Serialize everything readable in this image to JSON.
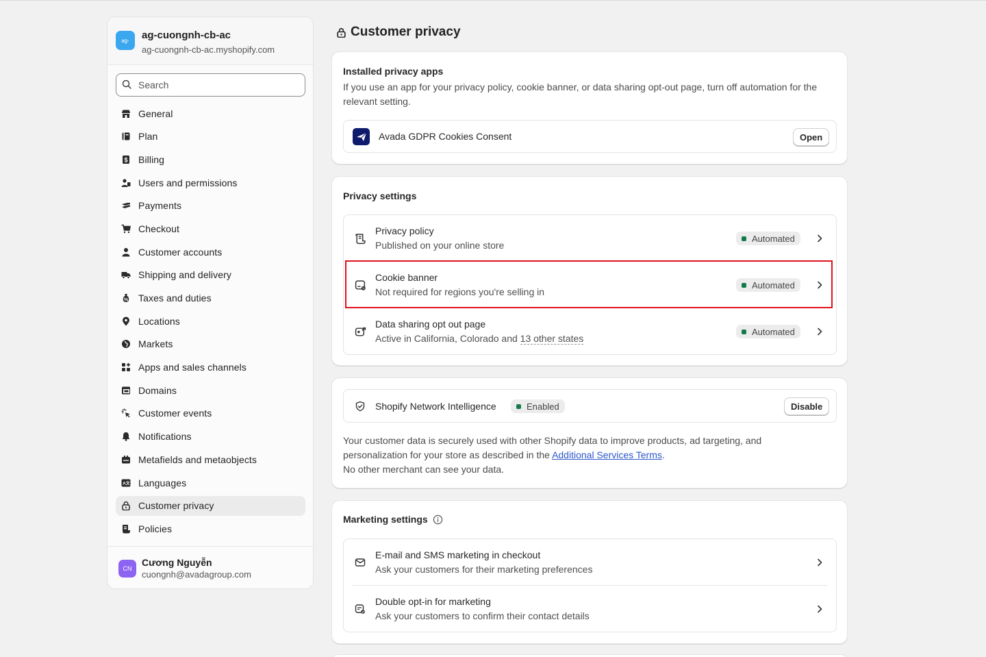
{
  "store": {
    "avatar_text": "ag-",
    "name": "ag-cuongnh-cb-ac",
    "domain": "ag-cuongnh-cb-ac.myshopify.com"
  },
  "search": {
    "placeholder": "Search"
  },
  "nav": [
    {
      "label": "General",
      "icon": "store-icon"
    },
    {
      "label": "Plan",
      "icon": "plan-icon"
    },
    {
      "label": "Billing",
      "icon": "billing-icon"
    },
    {
      "label": "Users and permissions",
      "icon": "users-icon"
    },
    {
      "label": "Payments",
      "icon": "payments-icon"
    },
    {
      "label": "Checkout",
      "icon": "cart-icon"
    },
    {
      "label": "Customer accounts",
      "icon": "person-icon"
    },
    {
      "label": "Shipping and delivery",
      "icon": "truck-icon"
    },
    {
      "label": "Taxes and duties",
      "icon": "tax-icon"
    },
    {
      "label": "Locations",
      "icon": "location-icon"
    },
    {
      "label": "Markets",
      "icon": "globe-icon"
    },
    {
      "label": "Apps and sales channels",
      "icon": "apps-icon"
    },
    {
      "label": "Domains",
      "icon": "domains-icon"
    },
    {
      "label": "Customer events",
      "icon": "cursor-click-icon"
    },
    {
      "label": "Notifications",
      "icon": "bell-icon"
    },
    {
      "label": "Metafields and metaobjects",
      "icon": "metafields-icon"
    },
    {
      "label": "Languages",
      "icon": "language-icon"
    },
    {
      "label": "Customer privacy",
      "icon": "lock-icon",
      "active": true
    },
    {
      "label": "Policies",
      "icon": "policies-icon"
    }
  ],
  "user": {
    "initials": "CN",
    "name": "Cương Nguyễn",
    "email": "cuongnh@avadagroup.com"
  },
  "page": {
    "title": "Customer privacy"
  },
  "installed_apps": {
    "title": "Installed privacy apps",
    "description": "If you use an app for your privacy policy, cookie banner, or data sharing opt-out page, turn off automation for the relevant setting.",
    "app_name": "Avada GDPR Cookies Consent",
    "open_label": "Open"
  },
  "privacy_settings": {
    "title": "Privacy settings",
    "rows": [
      {
        "title": "Privacy policy",
        "subtitle": "Published on your online store",
        "badge": "Automated"
      },
      {
        "title": "Cookie banner",
        "subtitle": "Not required for regions you're selling in",
        "badge": "Automated"
      },
      {
        "title": "Data sharing opt out page",
        "subtitle_prefix": "Active in California, Colorado and ",
        "subtitle_link": "13 other states",
        "badge": "Automated"
      }
    ]
  },
  "network": {
    "title": "Shopify Network Intelligence",
    "badge": "Enabled",
    "disable_label": "Disable",
    "desc_line1": "Your customer data is securely used with other Shopify data to improve products, ad targeting, and",
    "desc_line2_prefix": "personalization for your store as described in the ",
    "desc_link": "Additional Services Terms",
    "desc_line2_suffix": ".",
    "desc_line3": "No other merchant can see your data."
  },
  "marketing": {
    "title": "Marketing settings",
    "rows": [
      {
        "title": "E-mail and SMS marketing in checkout",
        "subtitle": "Ask your customers for their marketing preferences"
      },
      {
        "title": "Double opt-in for marketing",
        "subtitle": "Ask your customers to confirm their contact details"
      }
    ]
  },
  "colors": {
    "accent_green": "#147a4c",
    "highlight_red": "#e0101c",
    "link_blue": "#2c57c9"
  }
}
